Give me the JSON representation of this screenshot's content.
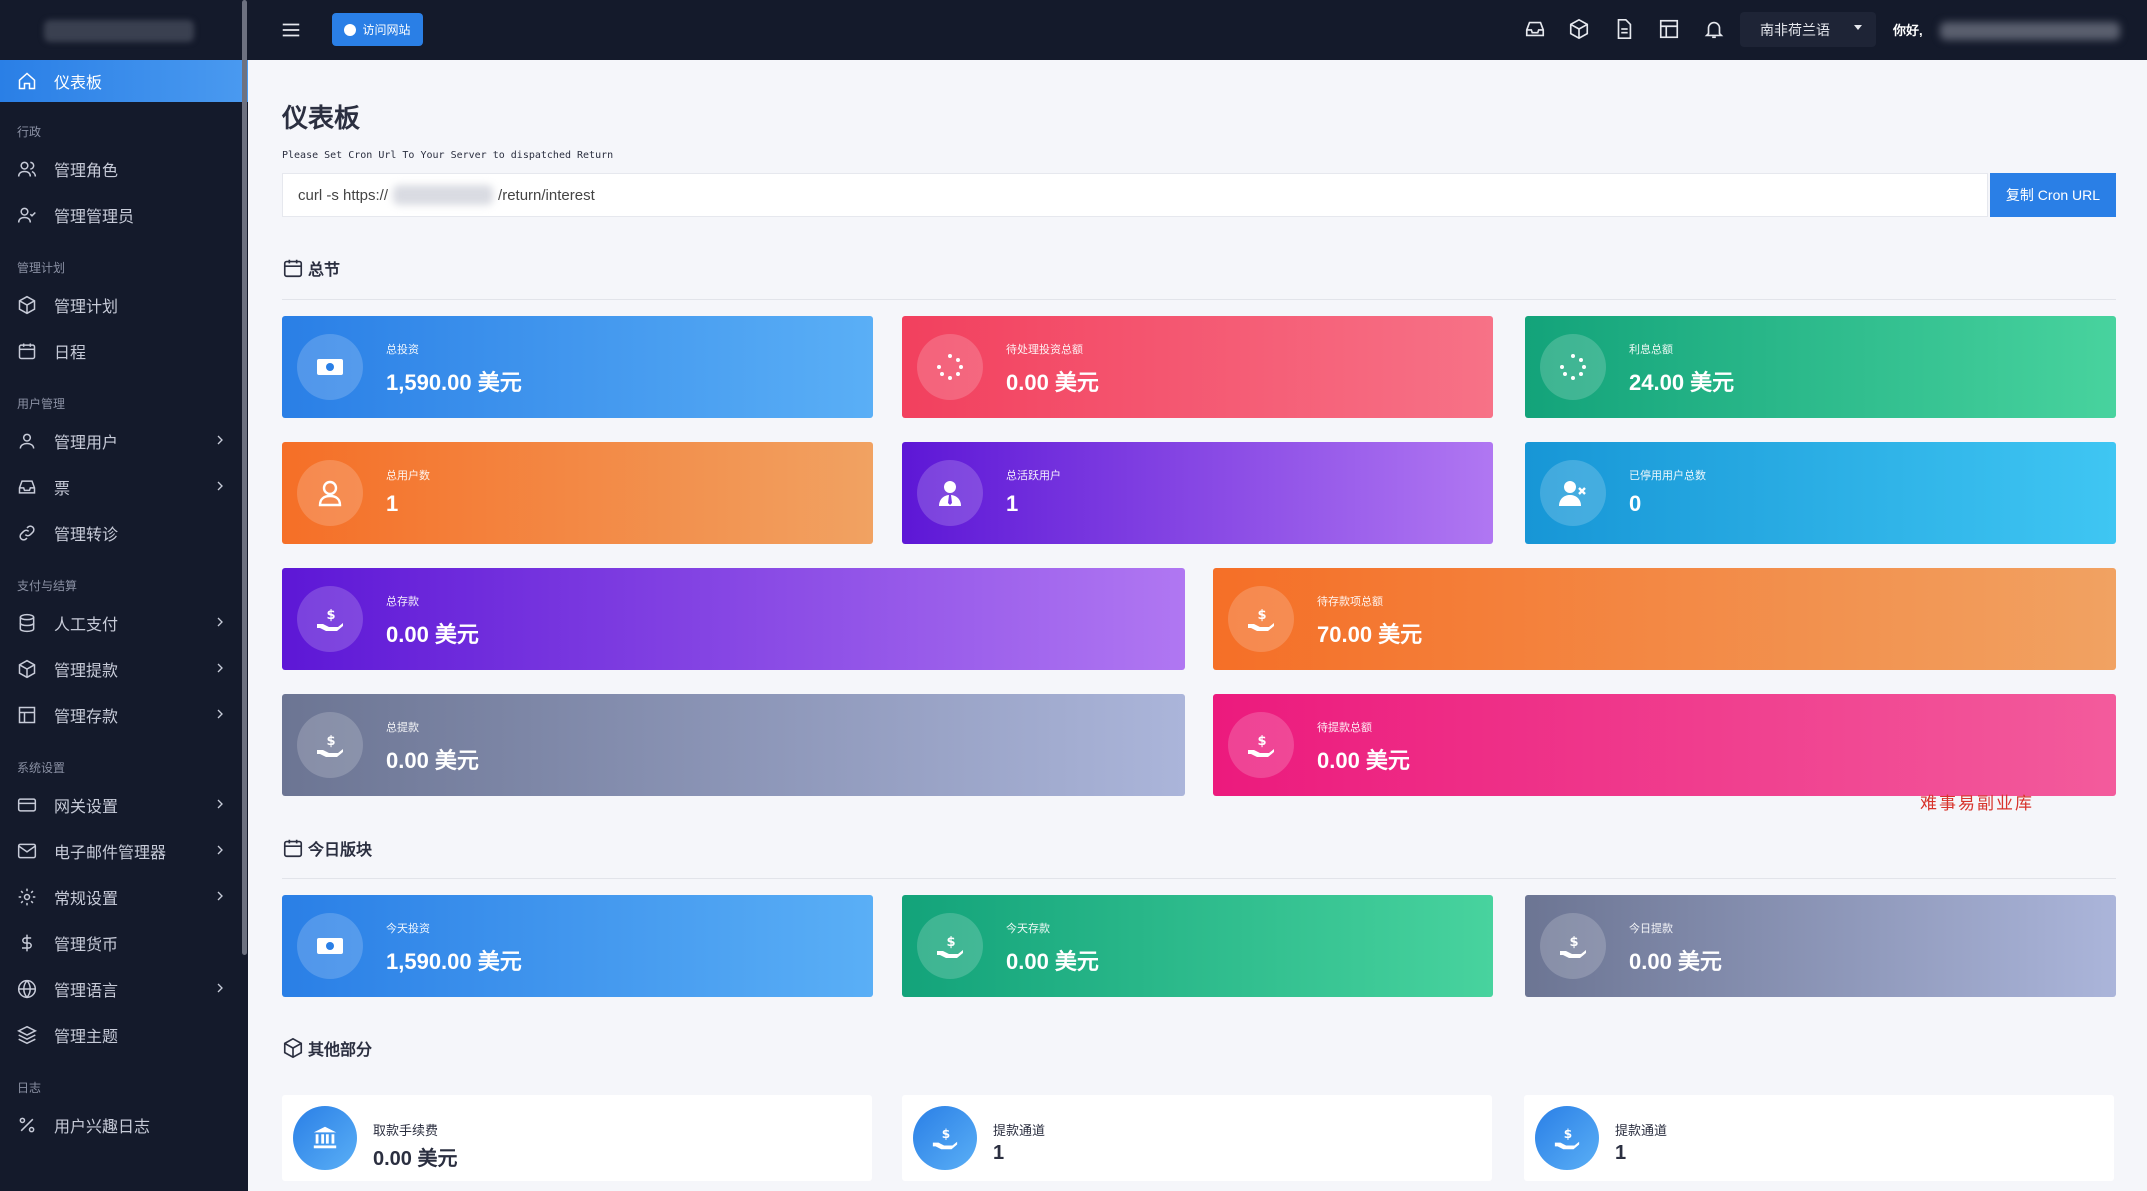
{
  "sidebar": {
    "items": [
      {
        "label": "仪表板",
        "icon": "home-icon",
        "active": true
      },
      {
        "section": "行政"
      },
      {
        "label": "管理角色",
        "icon": "users-icon"
      },
      {
        "label": "管理管理员",
        "icon": "user-check-icon"
      },
      {
        "section": "管理计划"
      },
      {
        "label": "管理计划",
        "icon": "box-icon"
      },
      {
        "label": "日程",
        "icon": "calendar-icon"
      },
      {
        "section": "用户管理"
      },
      {
        "label": "管理用户",
        "icon": "user-icon",
        "chevron": true
      },
      {
        "label": "票",
        "icon": "inbox-icon",
        "chevron": true
      },
      {
        "label": "管理转诊",
        "icon": "link-icon"
      },
      {
        "section": "支付与结算"
      },
      {
        "label": "人工支付",
        "icon": "database-icon",
        "chevron": true
      },
      {
        "label": "管理提款",
        "icon": "box-icon",
        "chevron": true
      },
      {
        "label": "管理存款",
        "icon": "layout-icon",
        "chevron": true
      },
      {
        "section": "系统设置"
      },
      {
        "label": "网关设置",
        "icon": "credit-card-icon",
        "chevron": true
      },
      {
        "label": "电子邮件管理器",
        "icon": "mail-icon",
        "chevron": true
      },
      {
        "label": "常规设置",
        "icon": "settings-icon",
        "chevron": true
      },
      {
        "label": "管理货币",
        "icon": "dollar-icon"
      },
      {
        "label": "管理语言",
        "icon": "globe-icon",
        "chevron": true
      },
      {
        "label": "管理主题",
        "icon": "layers-icon"
      },
      {
        "section": "日志"
      },
      {
        "label": "用户兴趣日志",
        "icon": "percent-icon"
      }
    ]
  },
  "topbar": {
    "visit_label": "访问网站",
    "language": "南非荷兰语",
    "greeting": "你好,"
  },
  "page": {
    "title": "仪表板",
    "cron_note": "Please Set Cron Url To Your Server to dispatched Return",
    "cron_prefix": "curl -s https://",
    "cron_suffix": "/return/interest",
    "copy_button": "复制 Cron URL"
  },
  "sections": {
    "summary": "总节",
    "today": "今日版块",
    "other": "其他部分"
  },
  "summary_cards": [
    {
      "label": "总投资",
      "value": "1,590.00 美元",
      "icon": "money-icon"
    },
    {
      "label": "待处理投资总额",
      "value": "0.00 美元",
      "icon": "loader-icon"
    },
    {
      "label": "利息总额",
      "value": "24.00 美元",
      "icon": "loader-icon"
    },
    {
      "label": "总用户数",
      "value": "1",
      "icon": "user-icon"
    },
    {
      "label": "总活跃用户",
      "value": "1",
      "icon": "user-tie-icon"
    },
    {
      "label": "已停用用户总数",
      "value": "0",
      "icon": "user-x-icon"
    },
    {
      "label": "总存款",
      "value": "0.00 美元",
      "icon": "hand-dollar-icon"
    },
    {
      "label": "待存款项总额",
      "value": "70.00 美元",
      "icon": "hand-dollar-icon"
    },
    {
      "label": "总提款",
      "value": "0.00 美元",
      "icon": "hand-dollar-icon"
    },
    {
      "label": "待提款总额",
      "value": "0.00 美元",
      "icon": "hand-dollar-icon"
    }
  ],
  "today_cards": [
    {
      "label": "今天投资",
      "value": "1,590.00 美元",
      "icon": "money-icon"
    },
    {
      "label": "今天存款",
      "value": "0.00 美元",
      "icon": "hand-dollar-icon"
    },
    {
      "label": "今日提款",
      "value": "0.00 美元",
      "icon": "hand-dollar-icon"
    }
  ],
  "other_cards": [
    {
      "label": "取款手续费",
      "value": "0.00 美元",
      "icon": "bank-icon"
    },
    {
      "label": "提款通道",
      "value": "1",
      "icon": "hand-dollar-icon"
    },
    {
      "label": "提款通道",
      "value": "1",
      "icon": "hand-dollar-icon"
    }
  ],
  "watermark": "难事易副业库"
}
